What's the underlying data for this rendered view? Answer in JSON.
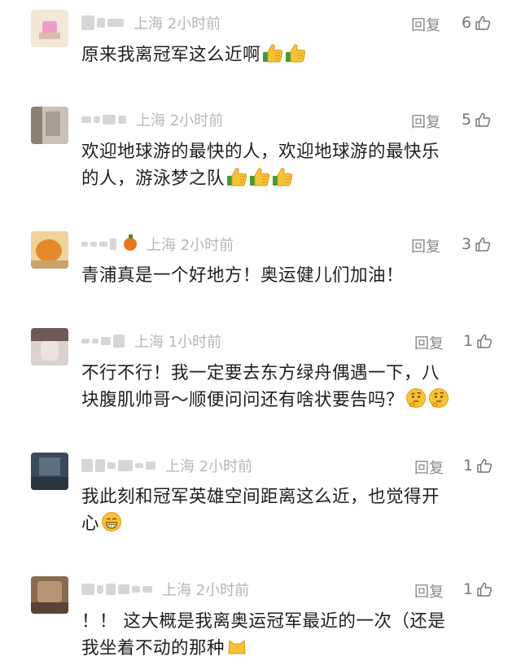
{
  "comments": [
    {
      "location_time": "上海 2小时前",
      "reply_label": "回复",
      "likes": "6",
      "text": "原来我离冠军这么近啊",
      "emoji": [
        "thumbs-up",
        "thumbs-up"
      ]
    },
    {
      "location_time": "上海 2小时前",
      "reply_label": "回复",
      "likes": "5",
      "text_line1": "欢迎地球游的最快的人，欢迎地球游的最快乐",
      "text_line2": "的人，游泳梦之队",
      "emoji": [
        "thumbs-up",
        "thumbs-up",
        "thumbs-up"
      ]
    },
    {
      "location_time": "上海 2小时前",
      "reply_label": "回复",
      "likes": "3",
      "text": "青浦真是一个好地方！奥运健儿们加油！",
      "nick_icon": "orange-icon"
    },
    {
      "location_time": "上海 1小时前",
      "reply_label": "回复",
      "likes": "1",
      "text_line1": "不行不行！我一定要去东方绿舟偶遇一下，八",
      "text_line2": "块腹肌帅哥～顺便问问还有啥状要告吗？",
      "emoji": [
        "thinking-face",
        "thinking-face"
      ]
    },
    {
      "location_time": "上海 2小时前",
      "reply_label": "回复",
      "likes": "1",
      "text_line1": "我此刻和冠军英雄空间距离这么近，也觉得开",
      "text_line2": "心",
      "emoji": [
        "grinning-face"
      ]
    },
    {
      "location_time": "上海 2小时前",
      "reply_label": "回复",
      "likes": "1",
      "text_line1": "！！ 这大概是我离奥运冠军最近的一次（还是",
      "text_line2": "我坐着不动的那种"
    }
  ],
  "colors": {
    "meta_text": "#b7b7b7",
    "reply_text": "#8a8a8a",
    "body_text": "#1e1e1e",
    "emoji_yellow": "#f7c234",
    "thumb_green": "#3e9b3a"
  }
}
